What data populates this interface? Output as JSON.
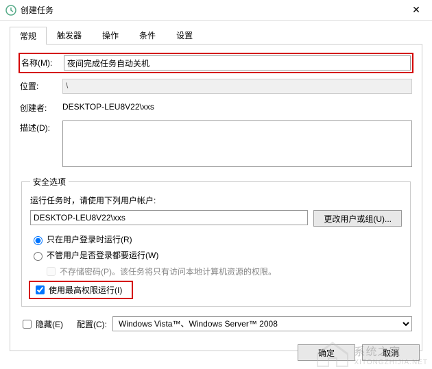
{
  "window": {
    "title": "创建任务"
  },
  "tabs": [
    "常规",
    "触发器",
    "操作",
    "条件",
    "设置"
  ],
  "general": {
    "name_label": "名称(M):",
    "name_value": "夜间完成任务自动关机",
    "location_label": "位置:",
    "location_value": "\\",
    "author_label": "创建者:",
    "author_value": "DESKTOP-LEU8V22\\xxs",
    "description_label": "描述(D):",
    "description_value": ""
  },
  "security": {
    "legend": "安全选项",
    "run_as_label": "运行任务时，请使用下列用户帐户:",
    "account": "DESKTOP-LEU8V22\\xxs",
    "change_user_btn": "更改用户或组(U)...",
    "radio_logged_on": "只在用户登录时运行(R)",
    "radio_any": "不管用户是否登录都要运行(W)",
    "no_store_pwd": "不存储密码(P)。该任务将只有访问本地计算机资源的权限。",
    "highest_priv": "使用最高权限运行(I)",
    "radio_selected": "logged_on",
    "highest_priv_checked": true,
    "no_store_pwd_checked": false
  },
  "bottom": {
    "hidden_label": "隐藏(E)",
    "hidden_checked": false,
    "configure_label": "配置(C):",
    "configure_value": "Windows Vista™、Windows Server™ 2008"
  },
  "buttons": {
    "ok": "确定",
    "cancel": "取消"
  },
  "watermark": {
    "name": "系统之家",
    "url": "XITONGZHIJIA.NET"
  }
}
